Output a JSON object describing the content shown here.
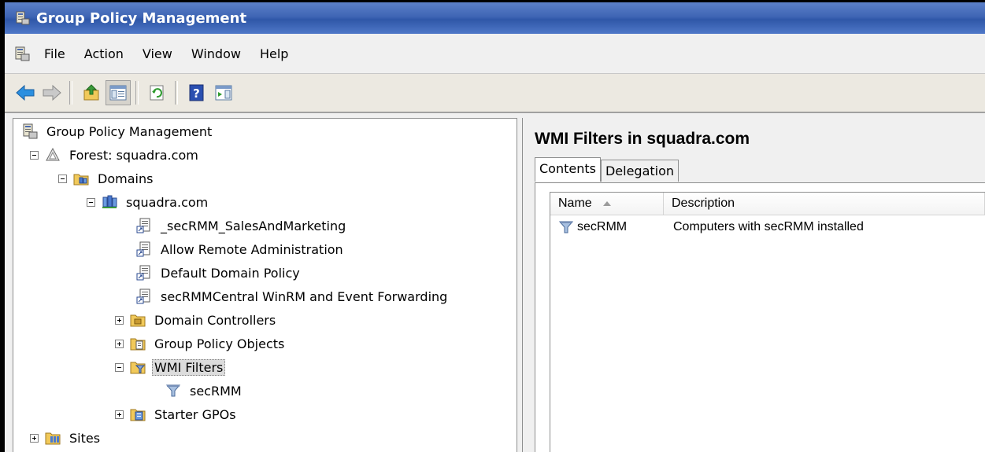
{
  "window": {
    "title": "Group Policy Management"
  },
  "menu": [
    "File",
    "Action",
    "View",
    "Window",
    "Help"
  ],
  "toolbar": {
    "buttons": [
      "back-icon",
      "forward-icon",
      "up-folder-icon",
      "show-hide-tree-icon",
      "refresh-icon",
      "help-icon",
      "action-pane-icon"
    ]
  },
  "tree": {
    "root": "Group Policy Management",
    "forest": "Forest: squadra.com",
    "domains": "Domains",
    "domain": "squadra.com",
    "gpo_links": [
      "_secRMM_SalesAndMarketing",
      "Allow Remote Administration",
      "Default Domain Policy",
      "secRMMCentral WinRM and Event Forwarding"
    ],
    "domain_controllers": "Domain Controllers",
    "gpo_container": "Group Policy Objects",
    "wmi_filters": "WMI Filters",
    "wmi_child": "secRMM",
    "starter_gpos": "Starter GPOs",
    "sites": "Sites"
  },
  "details": {
    "title": "WMI Filters in squadra.com",
    "tabs": [
      "Contents",
      "Delegation"
    ],
    "columns": [
      "Name",
      "Description"
    ],
    "rows": [
      {
        "name": "secRMM",
        "description": "Computers with secRMM installed"
      }
    ]
  },
  "colors": {
    "titlebar": "#3f65b4",
    "selection": "#dcdcdc"
  }
}
